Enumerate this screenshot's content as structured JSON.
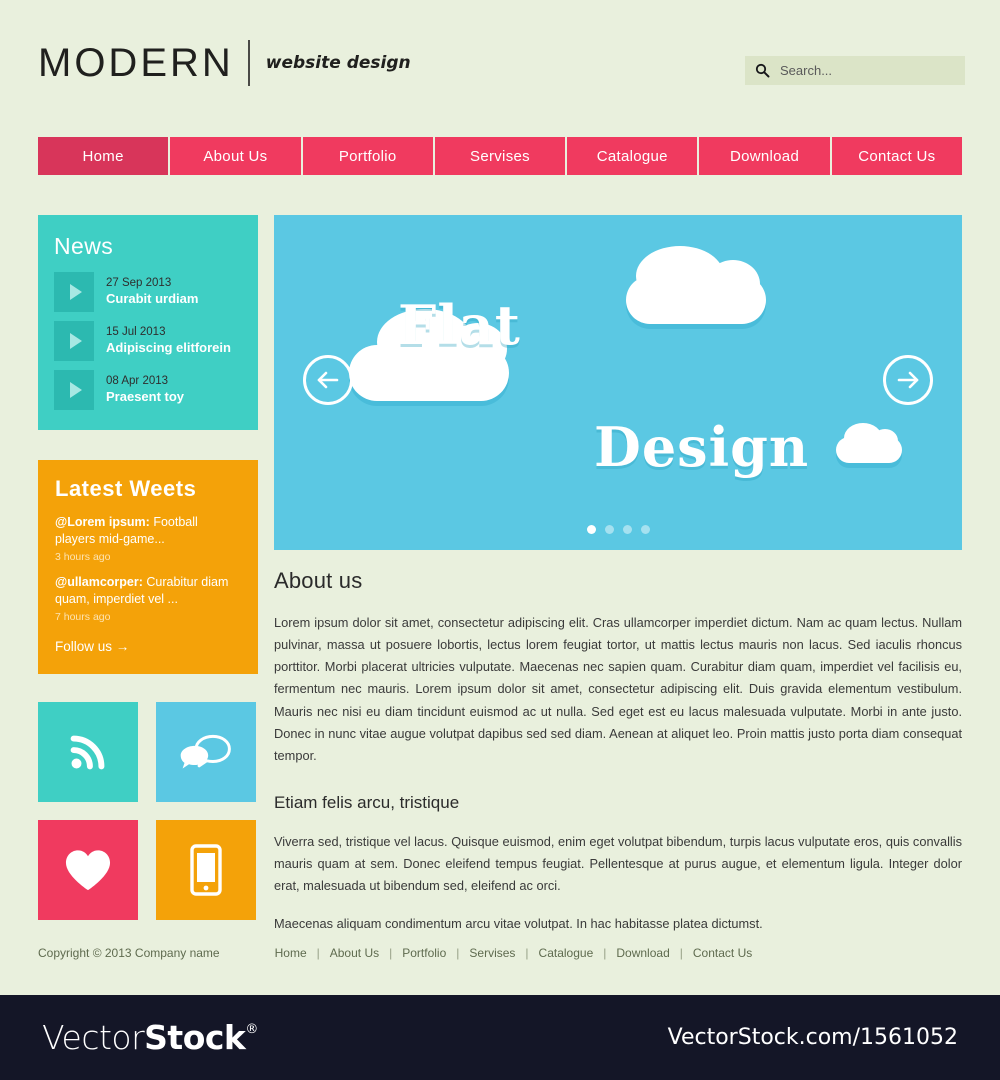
{
  "header": {
    "logo_main": "MODERN",
    "logo_sub": "website design",
    "search_placeholder": "Search...",
    "search_value": ""
  },
  "nav": {
    "items": [
      {
        "label": "Home",
        "active": true
      },
      {
        "label": "About Us",
        "active": false
      },
      {
        "label": "Portfolio",
        "active": false
      },
      {
        "label": "Servises",
        "active": false
      },
      {
        "label": "Catalogue",
        "active": false
      },
      {
        "label": "Download",
        "active": false
      },
      {
        "label": "Contact Us",
        "active": false
      }
    ]
  },
  "sidebar": {
    "news": {
      "title": "News",
      "items": [
        {
          "date": "27 Sep 2013",
          "headline": "Curabit urdiam"
        },
        {
          "date": "15 Jul 2013",
          "headline": "Adipiscing elitforein"
        },
        {
          "date": "08 Apr 2013",
          "headline": "Praesent toy"
        }
      ]
    },
    "tweets": {
      "title": "Latest  Weets",
      "items": [
        {
          "user": "@Lorem ipsum:",
          "text": " Football players mid-game...",
          "time": "3 hours ago"
        },
        {
          "user": "@ullamcorper:",
          "text": " Curabitur diam quam, imperdiet vel ...",
          "time": "7 hours ago"
        }
      ],
      "follow_label": "Follow us →"
    },
    "tiles": [
      {
        "icon": "rss-icon",
        "color": "#3fcfc4"
      },
      {
        "icon": "chat-icon",
        "color": "#5bc8e3"
      },
      {
        "icon": "heart-icon",
        "color": "#f03a5f"
      },
      {
        "icon": "mobile-icon",
        "color": "#f4a209"
      }
    ]
  },
  "hero": {
    "word1": "Flat",
    "word2": "Design",
    "prev_label": "previous slide",
    "next_label": "next slide",
    "dots": [
      {
        "active": true
      },
      {
        "active": false
      },
      {
        "active": false
      },
      {
        "active": false
      }
    ]
  },
  "article": {
    "heading": "About us",
    "paragraph1": "Lorem ipsum dolor sit amet, consectetur adipiscing elit. Cras ullamcorper imperdiet dictum. Nam ac quam lectus. Nullam pulvinar, massa ut posuere lobortis, lectus lorem feugiat tortor, ut mattis lectus mauris non lacus. Sed iaculis rhoncus porttitor. Morbi placerat ultricies vulputate. Maecenas nec sapien quam. Curabitur diam quam, imperdiet vel facilisis eu, fermentum nec mauris. Lorem ipsum dolor sit amet, consectetur adipiscing elit. Duis gravida elementum vestibulum. Mauris nec nisi eu diam tincidunt euismod ac ut nulla. Sed eget est eu lacus malesuada vulputate. Morbi in ante justo. Donec in nunc vitae augue volutpat dapibus sed sed diam. Aenean at aliquet leo. Proin mattis justo porta diam consequat tempor.",
    "subheading": "Etiam felis arcu, tristique",
    "paragraph2": "Viverra sed, tristique vel lacus. Quisque euismod, enim eget volutpat bibendum, turpis lacus vulputate eros, quis convallis mauris quam at sem. Donec eleifend tempus feugiat. Pellentesque at purus augue, et elementum ligula. Integer dolor erat, malesuada ut bibendum sed, eleifend ac orci.",
    "paragraph3": "Maecenas aliquam condimentum arcu vitae volutpat. In hac habitasse platea dictumst."
  },
  "footer": {
    "copyright": "Copyright © 2013 Company name",
    "links": [
      "Home",
      "About Us",
      "Portfolio",
      "Servises",
      "Catalogue",
      "Download",
      "Contact Us"
    ],
    "separator": "|"
  },
  "watermark": {
    "brand_light": "Vector",
    "brand_bold": "Stock",
    "registered": "®",
    "url": "VectorStock.com/1561052"
  },
  "colors": {
    "page_bg": "#e9f0dd",
    "nav": "#f03a5f",
    "nav_active": "#d8355a",
    "teal": "#3fcfc4",
    "teal_dark": "#2cb9b0",
    "orange": "#f4a209",
    "sky": "#5bc8e3",
    "watermark_bg": "#141627"
  }
}
